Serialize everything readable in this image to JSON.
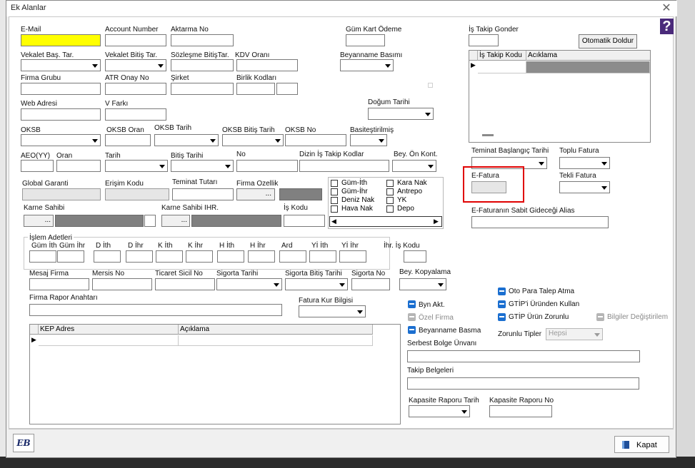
{
  "window": {
    "title": "Ek Alanlar",
    "close_glyph": "✕"
  },
  "help_glyph": "?",
  "fields": {
    "email": "E-Mail",
    "account_number": "Account Number",
    "aktarma_no": "Aktarma No",
    "gum_kart_odeme": "Güm Kart Ödeme",
    "is_takip_gonder": "İş Takip Gonder",
    "otomatik_doldur": "Otomatik Doldur",
    "vekalet_bas_tar": "Vekalet Baş. Tar.",
    "vekalet_bitis_tar": "Vekalet Bitiş Tar.",
    "sozlesme_bitis_tar": "Sözleşme BitişTar.",
    "kdv_orani": "KDV Oranı",
    "beyanname_basimi": "Beyanname Basımı",
    "firma_grubu": "Firma Grubu",
    "atr_onay_no": "ATR Onay No",
    "sirket": "Şirket",
    "birlik_kodlari": "Birlik Kodları",
    "web_adresi": "Web Adresi",
    "v_farki": "V Farkı",
    "dogum_tarihi": "Doğum Tarihi",
    "oksb": "OKSB",
    "oksb_oran": "OKSB Oran",
    "oksb_tarih": "OKSB Tarih",
    "oksb_bitis_tarih": "OKSB Bitiş Tarih",
    "oksb_no": "OKSB No",
    "basitestirilmis": "Basiteştirilmiş",
    "aeo_yy": "AEO(YY)",
    "oran": "Oran",
    "tarih": "Tarih",
    "bitis_tarihi": "Bitiş Tarihi",
    "no": "No",
    "dizin_is_takip_kodlar": "Dizin İş Takip Kodlar",
    "bey_on_kont": "Bey. Ön Kont.",
    "global_garanti": "Global Garanti",
    "erisim_kodu": "Erişim Kodu",
    "teminat_tutari": "Teminat Tutarı",
    "firma_ozellik": "Firma Ozellik",
    "karne_sahibi": "Karne Sahibi",
    "karne_sahibi_ihr": "Karne Sahibi IHR.",
    "is_kodu": "İş Kodu",
    "teminat_baslangic_tarihi": "Teminat Başlangıç Tarihi",
    "toplu_fatura": "Toplu Fatura",
    "e_fatura": "E-Fatura",
    "tekli_fatura": "Tekli Fatura",
    "e_fatura_alias": "E-Faturanın Sabit Gideceği Alias",
    "islem_adetleri": "İşlem Adetleri",
    "ihr_is_kodu": "İhr. İş Kodu",
    "mesaj_firma": "Mesaj Firma",
    "mersis_no": "Mersis No",
    "ticaret_sicil_no": "Ticaret Sicil No",
    "sigorta_tarihi": "Sigorta Tarihi",
    "sigorta_bitis_tarihi": "Sigorta Bitiş Tarihi",
    "sigorta_no": "Sigorta No",
    "bey_kopyalama": "Bey. Kopyalama",
    "firma_rapor_anahtari": "Firma Rapor Anahtarı",
    "fatura_kur_bilgisi": "Fatura Kur Bilgisi",
    "zorunlu_tipler": "Zorunlu Tipler",
    "zorunlu_tipler_value": "Hepsi",
    "serbest_bolge_unvani": "Serbest Bolge Ünvanı",
    "takip_belgeleri": "Takip Belgeleri",
    "kapasite_raporu_tarih": "Kapasite Raporu Tarih",
    "kapasite_raporu_no": "Kapasite Raporu No",
    "ellipsis": "..."
  },
  "islem_columns": [
    "Güm İth",
    "Güm İhr",
    "D İth",
    "D İhr",
    "K İth",
    "K İhr",
    "H İth",
    "H İhr",
    "Ard",
    "Yİ İth",
    "Yİ İhr"
  ],
  "checkboxes_left": [
    "Güm-İth",
    "Güm-İhr",
    "Deniz Nak",
    "Hava Nak"
  ],
  "checkboxes_right": [
    "Kara Nak",
    "Antrepo",
    "YK",
    "Depo"
  ],
  "toggles": {
    "byn_akt": "Byn Akt.",
    "ozel_firma": "Özel Firma",
    "beyanname_basma": "Beyanname Basma",
    "oto_para_talep": "Oto Para Talep Atma",
    "gtip_urunden": "GTİP'i Üründen Kullan",
    "gtip_urun_zorunlu": "GTİP Ürün Zorunlu",
    "bilgiler_degistirilem": "Bilgiler Değiştirilem"
  },
  "is_takip_grid": {
    "columns": [
      "İş Takip Kodu",
      "Acıklama"
    ]
  },
  "kep_grid": {
    "columns": [
      "KEP Adres",
      "Açıklama"
    ]
  },
  "footer": {
    "kapat": "Kapat",
    "logo": "EB"
  },
  "accent_colors": {
    "highlight_red": "#e00000",
    "toggle_blue": "#1b6fd0",
    "email_yellow": "#ffff00"
  }
}
